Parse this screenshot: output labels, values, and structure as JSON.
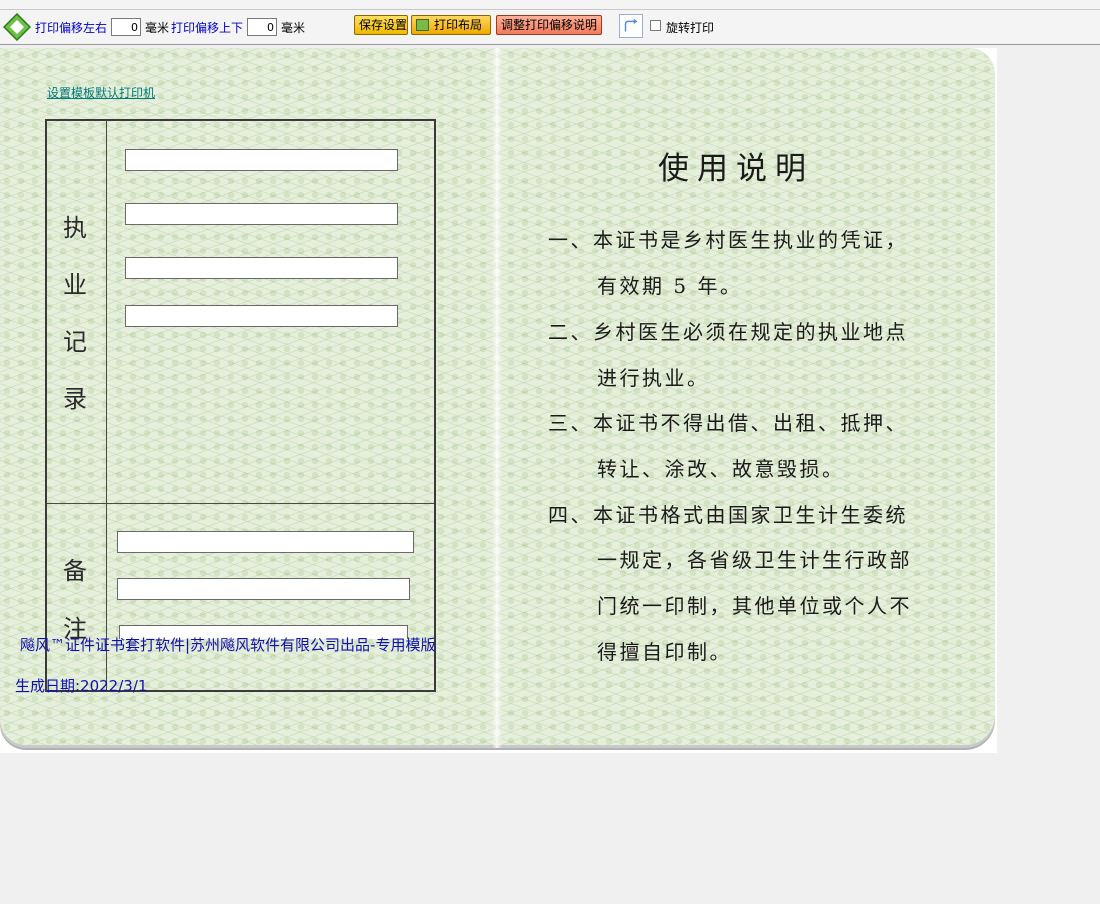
{
  "toolbar": {
    "offset_lr_label": "打印偏移左右",
    "offset_lr_value": "0",
    "unit_mm": "毫米",
    "offset_ud_label": "打印偏移上下",
    "offset_ud_value": "0",
    "unit_mm2": "毫米",
    "save_button": "保存设置",
    "layout_button": "打印布局",
    "adjust_button": "调整打印偏移说明",
    "rotate_label": "旋转打印"
  },
  "certificate": {
    "set_printer_link": "设置模板默认打印机",
    "left_page": {
      "practice_record_chars": [
        "执",
        "业",
        "记",
        "录"
      ],
      "remarks_chars": [
        "备",
        "注"
      ]
    },
    "right_page": {
      "title": "使用说明",
      "lines": [
        "一、本证书是乡村医生执业的凭证，",
        "有效期 5 年。",
        "二、乡村医生必须在规定的执业地点",
        "进行执业。",
        "三、本证书不得出借、出租、抵押、",
        "转让、涂改、故意毁损。",
        "四、本证书格式由国家卫生计生委统",
        "一规定，各省级卫生计生行政部",
        "门统一印制，其他单位或个人不",
        "得擅自印制。"
      ]
    },
    "footer": {
      "brand": "飚风™证件证书套打软件|苏州飚风软件有限公司出品-专用模版",
      "date": "生成日期:2022/3/1"
    }
  }
}
